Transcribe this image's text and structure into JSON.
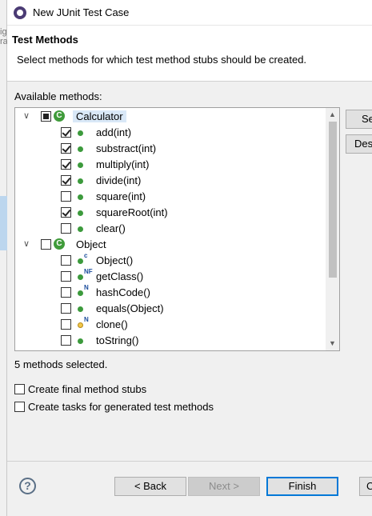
{
  "background": {
    "fragments": [
      {
        "text": "ig"
      },
      {
        "text": "ra"
      }
    ]
  },
  "window": {
    "title": "New JUnit Test Case",
    "icon": "eclipse-icon"
  },
  "header": {
    "title": "Test Methods",
    "description": "Select methods for which test method stubs should be created."
  },
  "available_label": "Available methods:",
  "tree": {
    "classes": [
      {
        "name": "Calculator",
        "check_state": "partial",
        "expanded": true,
        "selected": true,
        "methods": [
          {
            "name": "add(int)",
            "checked": true,
            "modifier": "",
            "visibility": "public"
          },
          {
            "name": "substract(int)",
            "checked": true,
            "modifier": "",
            "visibility": "public"
          },
          {
            "name": "multiply(int)",
            "checked": true,
            "modifier": "",
            "visibility": "public"
          },
          {
            "name": "divide(int)",
            "checked": true,
            "modifier": "",
            "visibility": "public"
          },
          {
            "name": "square(int)",
            "checked": false,
            "modifier": "",
            "visibility": "public"
          },
          {
            "name": "squareRoot(int)",
            "checked": true,
            "modifier": "",
            "visibility": "public"
          },
          {
            "name": "clear()",
            "checked": false,
            "modifier": "",
            "visibility": "public"
          }
        ]
      },
      {
        "name": "Object",
        "check_state": "unchecked",
        "expanded": true,
        "selected": false,
        "methods": [
          {
            "name": "Object()",
            "checked": false,
            "modifier": "c",
            "visibility": "public"
          },
          {
            "name": "getClass()",
            "checked": false,
            "modifier": "NF",
            "visibility": "public"
          },
          {
            "name": "hashCode()",
            "checked": false,
            "modifier": "N",
            "visibility": "public"
          },
          {
            "name": "equals(Object)",
            "checked": false,
            "modifier": "",
            "visibility": "public"
          },
          {
            "name": "clone()",
            "checked": false,
            "modifier": "N",
            "visibility": "protected"
          },
          {
            "name": "toString()",
            "checked": false,
            "modifier": "",
            "visibility": "public"
          }
        ]
      }
    ]
  },
  "side_buttons": {
    "select_all": "Se",
    "deselect_all": "Des"
  },
  "status": "5 methods selected.",
  "options": {
    "final_stubs": {
      "label": "Create final method stubs",
      "checked": false
    },
    "tasks": {
      "label": "Create tasks for generated test methods",
      "checked": false
    }
  },
  "buttons": {
    "help": "?",
    "back": "< Back",
    "next": "Next >",
    "finish": "Finish",
    "cancel": "C"
  },
  "colors": {
    "class_icon": "#3f9b3a",
    "method_icon": "#3c9a3c",
    "default_button_border": "#0078d7"
  }
}
